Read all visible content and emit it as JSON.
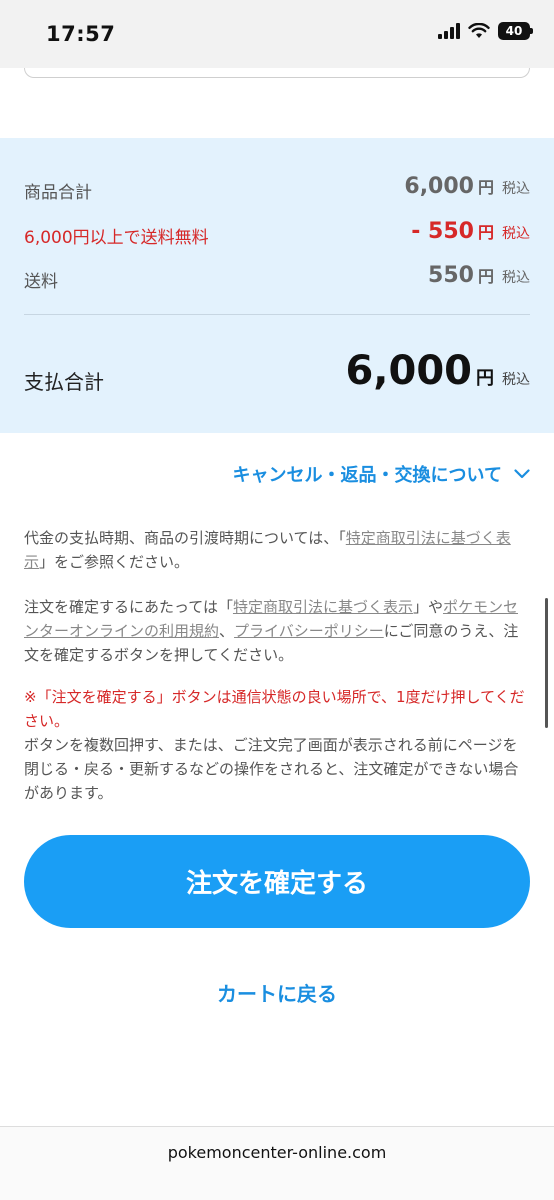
{
  "status_bar": {
    "time": "17:57",
    "battery": "40"
  },
  "summary": {
    "subtotal_label": "商品合計",
    "subtotal_value": "6,000",
    "discount_label": "6,000円以上で送料無料",
    "discount_value": "- 550",
    "shipping_label": "送料",
    "shipping_value": "550",
    "yen": "円",
    "tax": "税込",
    "total_label": "支払合計",
    "total_value": "6,000"
  },
  "cancel_link": "キャンセル・返品・交換について",
  "para1": {
    "t1": "代金の支払時期、商品の引渡時期については、「",
    "link1": "特定商取引法に基づく表示",
    "t2": "」をご参照ください。"
  },
  "para2": {
    "t1": "注文を確定するにあたっては「",
    "link1": "特定商取引法に基づく表示",
    "t2": "」や",
    "link2": "ポケモンセンターオンラインの利用規約",
    "t3": "、",
    "link3": "プライバシーポリシー",
    "t4": "にご同意のうえ、注文を確定するボタンを押してください。"
  },
  "warning": "※「注文を確定する」ボタンは通信状態の良い場所で、1度だけ押してください。",
  "note": "ボタンを複数回押す、または、ご注文完了画面が表示される前にページを閉じる・戻る・更新するなどの操作をされると、注文確定ができない場合があります。",
  "confirm_button": "注文を確定する",
  "back_link": "カートに戻る",
  "url": "pokemoncenter-online.com",
  "colors": {
    "accent": "#1a9ef5",
    "link": "#1a8ee0",
    "warning": "#d62828",
    "summary_bg": "#e3f2fd"
  }
}
